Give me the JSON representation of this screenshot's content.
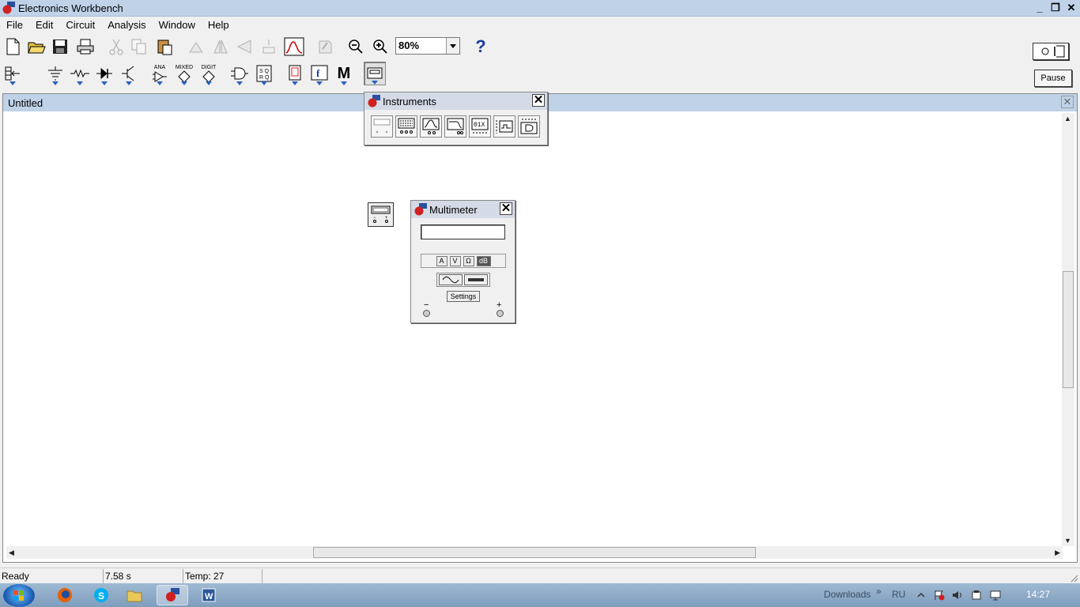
{
  "window": {
    "title": "Electronics Workbench",
    "minimize": "_",
    "restore": "❐",
    "close": "✕"
  },
  "menu": [
    "File",
    "Edit",
    "Circuit",
    "Analysis",
    "Window",
    "Help"
  ],
  "toolbar": {
    "zoom_value": "80%",
    "help_label": "?",
    "pause_label": "Pause"
  },
  "parts_bins": {
    "ana": "ANA",
    "mixed": "MIXED",
    "digit": "DIGIT",
    "misc": "M"
  },
  "document": {
    "title": "Untitled",
    "close": "✕"
  },
  "instruments_palette": {
    "title": "Instruments",
    "close": "✕",
    "items": [
      "multimeter-icon",
      "function-generator-icon",
      "oscilloscope-icon",
      "bode-plotter-icon",
      "word-generator-icon",
      "logic-analyzer-icon",
      "logic-converter-icon"
    ]
  },
  "multimeter": {
    "title": "Multimeter",
    "close": "✕",
    "modes": [
      "A",
      "V",
      "Ω",
      "dB"
    ],
    "active_mode": "dB",
    "settings_label": "Settings",
    "minus": "−",
    "plus": "+"
  },
  "status": {
    "ready": "Ready",
    "time": "7.58 s",
    "temp": "Temp:  27"
  },
  "taskbar": {
    "downloads": "Downloads",
    "chevron": "»",
    "lang": "RU",
    "clock": "14:27"
  }
}
